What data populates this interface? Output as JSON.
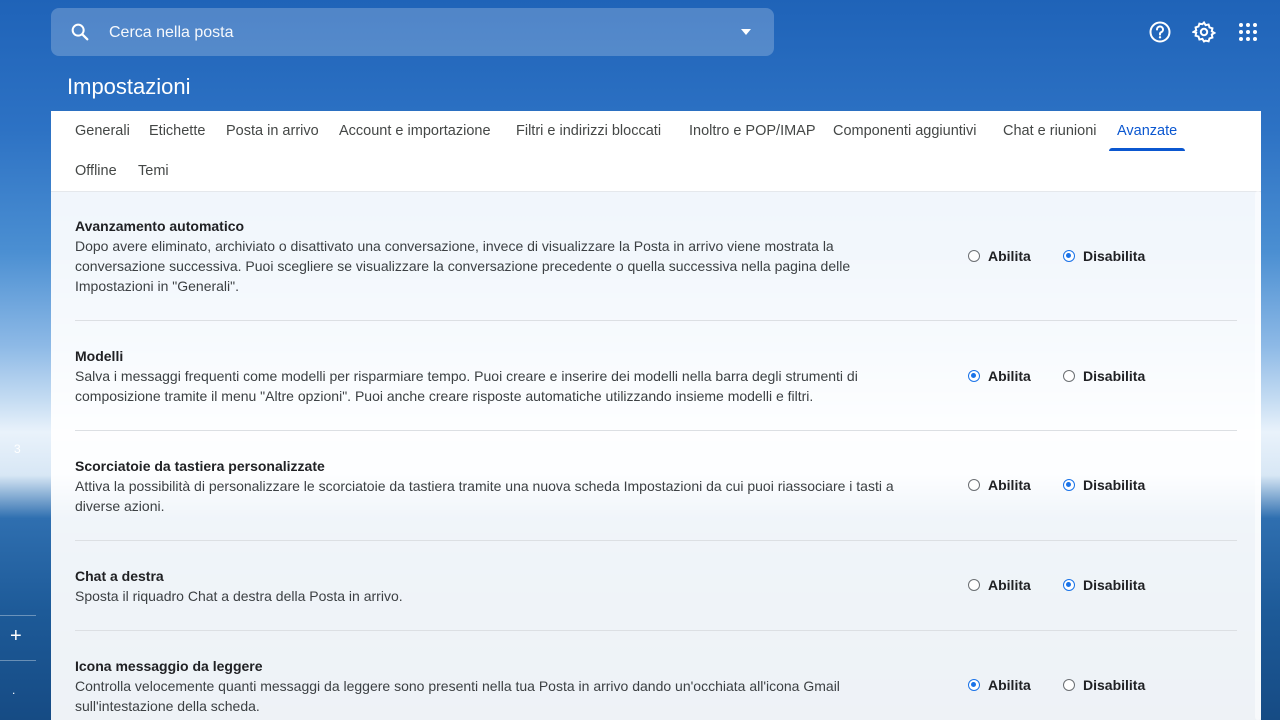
{
  "search": {
    "placeholder": "Cerca nella posta"
  },
  "icons": {
    "search": "search-icon",
    "dropdown": "chevron-down-icon",
    "help": "help-icon",
    "settings": "gear-icon",
    "apps": "apps-grid-icon"
  },
  "page": {
    "title": "Impostazioni"
  },
  "rail": {
    "count": "3",
    "plus": "+",
    "dot": "."
  },
  "tabs": [
    {
      "label": "Generali"
    },
    {
      "label": "Etichette"
    },
    {
      "label": "Posta in arrivo"
    },
    {
      "label": "Account e importazione"
    },
    {
      "label": "Filtri e indirizzi bloccati"
    },
    {
      "label": "Inoltro e POP/IMAP"
    },
    {
      "label": "Componenti aggiuntivi"
    },
    {
      "label": "Chat e riunioni"
    },
    {
      "label": "Avanzate"
    },
    {
      "label": "Offline"
    },
    {
      "label": "Temi"
    }
  ],
  "active_tab": "Avanzate",
  "options": {
    "enable": "Abilita",
    "disable": "Disabilita"
  },
  "settings": [
    {
      "title": "Avanzamento automatico",
      "desc": "Dopo avere eliminato, archiviato o disattivato una conversazione, invece di visualizzare la Posta in arrivo viene mostrata la conversazione successiva. Puoi scegliere se visualizzare la conversazione precedente o quella successiva nella pagina delle Impostazioni in \"Generali\".",
      "selected": "Disabilita"
    },
    {
      "title": "Modelli",
      "desc": "Salva i messaggi frequenti come modelli per risparmiare tempo. Puoi creare e inserire dei modelli nella barra degli strumenti di composizione tramite il menu \"Altre opzioni\". Puoi anche creare risposte automatiche utilizzando insieme modelli e filtri.",
      "selected": "Abilita"
    },
    {
      "title": "Scorciatoie da tastiera personalizzate",
      "desc": "Attiva la possibilità di personalizzare le scorciatoie da tastiera tramite una nuova scheda Impostazioni da cui puoi riassociare i tasti a diverse azioni.",
      "selected": "Disabilita"
    },
    {
      "title": "Chat a destra",
      "desc": "Sposta il riquadro Chat a destra della Posta in arrivo.",
      "selected": "Disabilita"
    },
    {
      "title": "Icona messaggio da leggere",
      "desc": "Controlla velocemente quanti messaggi da leggere sono presenti nella tua Posta in arrivo dando un'occhiata all'icona Gmail sull'intestazione della scheda.",
      "selected": "Abilita"
    }
  ],
  "colors": {
    "accent": "#0b57d0",
    "radio": "#1a73e8"
  }
}
